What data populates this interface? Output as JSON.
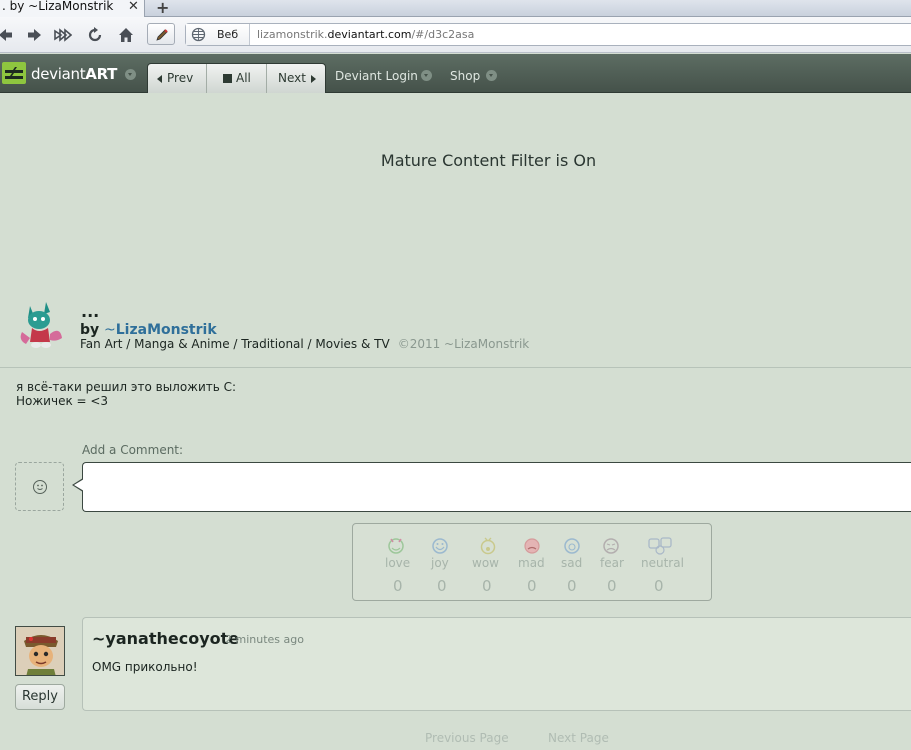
{
  "browser": {
    "tab_title": ". by ~LizaMonstrik",
    "tab_close": "✕",
    "new_tab": "+",
    "search_engine": "Веб",
    "url_host_prefix": "lizamonstrik.",
    "url_host_domain": "deviantart.com",
    "url_path": "/#/d3c2asa"
  },
  "header": {
    "brand_light": "deviant",
    "brand_bold": "ART",
    "prev_label": "Prev",
    "all_label": "All",
    "next_label": "Next",
    "login_label": "Deviant Login",
    "shop_label": "Shop"
  },
  "deviation": {
    "filter_notice": "Mature Content Filter is On",
    "title": "...",
    "by_label": "by",
    "author_symbol": "~",
    "author": "LizaMonstrik",
    "categories": "Fan Art / Manga & Anime / Traditional / Movies & TV",
    "copyright": "©2011 ~LizaMonstrik",
    "description_line1": "я всё-таки решил это выложить С:",
    "description_line2": "Ножичек = <3"
  },
  "comment_form": {
    "label": "Add a Comment:"
  },
  "moods": [
    {
      "label": "love",
      "count": "0",
      "icon": "love-icon",
      "color": "#9dc79a"
    },
    {
      "label": "joy",
      "count": "0",
      "icon": "joy-icon",
      "color": "#9bb9cf"
    },
    {
      "label": "wow",
      "count": "0",
      "icon": "wow-icon",
      "color": "#c9c98c"
    },
    {
      "label": "mad",
      "count": "0",
      "icon": "mad-icon",
      "color": "#d59b9b"
    },
    {
      "label": "sad",
      "count": "0",
      "icon": "sad-icon",
      "color": "#9bb9cf"
    },
    {
      "label": "fear",
      "count": "0",
      "icon": "fear-icon",
      "color": "#b3aeae"
    },
    {
      "label": "neutral",
      "count": "0",
      "icon": "neutral-icon",
      "color": "#a9b8c8"
    }
  ],
  "comments": [
    {
      "username": "~yanathecoyote",
      "time": "2 minutes ago",
      "text": "OMG прикольно!",
      "reply_label": "Reply"
    }
  ],
  "pagination": {
    "previous": "Previous Page",
    "next": "Next Page"
  },
  "colors": {
    "page_bg": "#d4ded2",
    "header_bg": "#4f5e55",
    "logo_green": "#8ec63f",
    "author_link": "#2f6f9a"
  }
}
